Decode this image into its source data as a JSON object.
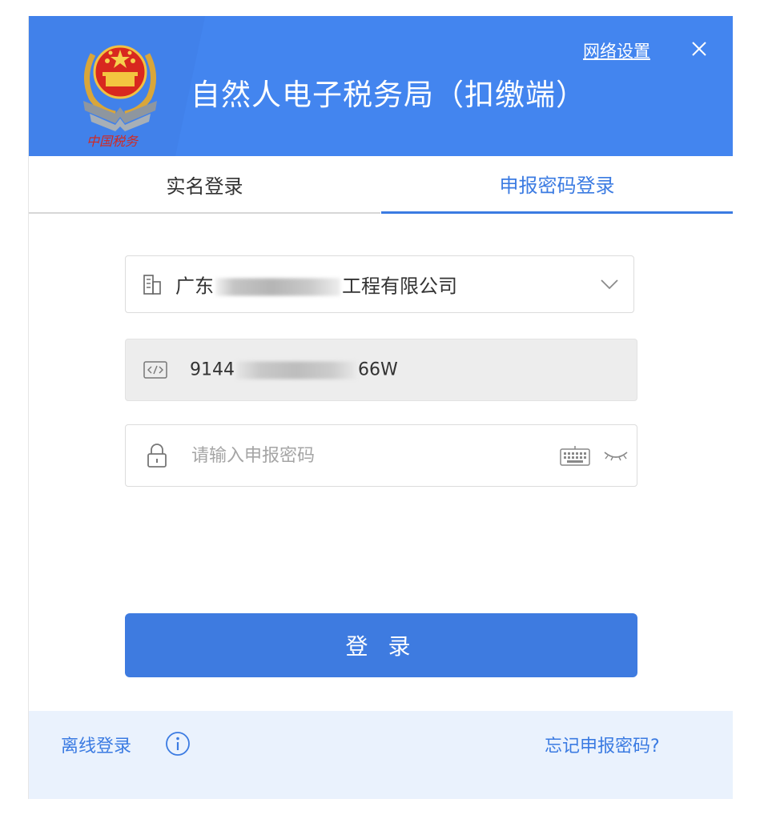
{
  "header": {
    "title": "自然人电子税务局（扣缴端）",
    "network_settings": "网络设置",
    "emblem_icon": "tax-bureau-emblem-icon",
    "close_icon": "close-icon"
  },
  "tabs": [
    {
      "label": "实名登录",
      "active": false
    },
    {
      "label": "申报密码登录",
      "active": true
    }
  ],
  "form": {
    "company": {
      "icon": "building-icon",
      "prefix": "广东",
      "suffix": "工程有限公司"
    },
    "tax_id": {
      "icon": "code-icon",
      "prefix": "9144",
      "suffix": "66W"
    },
    "password": {
      "icon": "lock-icon",
      "placeholder": "请输入申报密码"
    }
  },
  "login_button": "登 录",
  "footer": {
    "offline_login": "离线登录",
    "forgot_password": "忘记申报密码?"
  },
  "colors": {
    "header_bg": "#4385ef",
    "accent": "#3b7be2",
    "button_bg": "#3e7be0",
    "footer_bg": "#eaf2fd"
  }
}
